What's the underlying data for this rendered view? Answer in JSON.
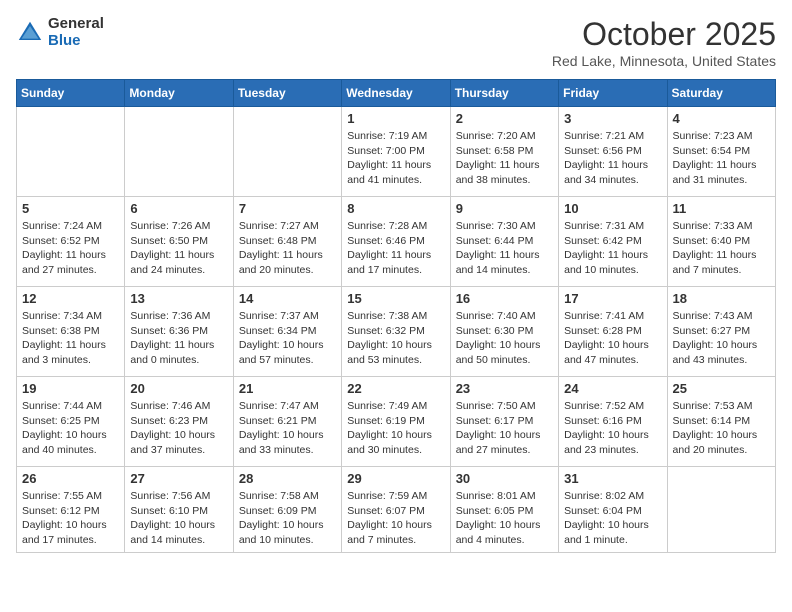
{
  "header": {
    "logo_general": "General",
    "logo_blue": "Blue",
    "month_title": "October 2025",
    "subtitle": "Red Lake, Minnesota, United States"
  },
  "calendar": {
    "days_of_week": [
      "Sunday",
      "Monday",
      "Tuesday",
      "Wednesday",
      "Thursday",
      "Friday",
      "Saturday"
    ],
    "weeks": [
      [
        {
          "day": "",
          "info": ""
        },
        {
          "day": "",
          "info": ""
        },
        {
          "day": "",
          "info": ""
        },
        {
          "day": "1",
          "info": "Sunrise: 7:19 AM\nSunset: 7:00 PM\nDaylight: 11 hours and 41 minutes."
        },
        {
          "day": "2",
          "info": "Sunrise: 7:20 AM\nSunset: 6:58 PM\nDaylight: 11 hours and 38 minutes."
        },
        {
          "day": "3",
          "info": "Sunrise: 7:21 AM\nSunset: 6:56 PM\nDaylight: 11 hours and 34 minutes."
        },
        {
          "day": "4",
          "info": "Sunrise: 7:23 AM\nSunset: 6:54 PM\nDaylight: 11 hours and 31 minutes."
        }
      ],
      [
        {
          "day": "5",
          "info": "Sunrise: 7:24 AM\nSunset: 6:52 PM\nDaylight: 11 hours and 27 minutes."
        },
        {
          "day": "6",
          "info": "Sunrise: 7:26 AM\nSunset: 6:50 PM\nDaylight: 11 hours and 24 minutes."
        },
        {
          "day": "7",
          "info": "Sunrise: 7:27 AM\nSunset: 6:48 PM\nDaylight: 11 hours and 20 minutes."
        },
        {
          "day": "8",
          "info": "Sunrise: 7:28 AM\nSunset: 6:46 PM\nDaylight: 11 hours and 17 minutes."
        },
        {
          "day": "9",
          "info": "Sunrise: 7:30 AM\nSunset: 6:44 PM\nDaylight: 11 hours and 14 minutes."
        },
        {
          "day": "10",
          "info": "Sunrise: 7:31 AM\nSunset: 6:42 PM\nDaylight: 11 hours and 10 minutes."
        },
        {
          "day": "11",
          "info": "Sunrise: 7:33 AM\nSunset: 6:40 PM\nDaylight: 11 hours and 7 minutes."
        }
      ],
      [
        {
          "day": "12",
          "info": "Sunrise: 7:34 AM\nSunset: 6:38 PM\nDaylight: 11 hours and 3 minutes."
        },
        {
          "day": "13",
          "info": "Sunrise: 7:36 AM\nSunset: 6:36 PM\nDaylight: 11 hours and 0 minutes."
        },
        {
          "day": "14",
          "info": "Sunrise: 7:37 AM\nSunset: 6:34 PM\nDaylight: 10 hours and 57 minutes."
        },
        {
          "day": "15",
          "info": "Sunrise: 7:38 AM\nSunset: 6:32 PM\nDaylight: 10 hours and 53 minutes."
        },
        {
          "day": "16",
          "info": "Sunrise: 7:40 AM\nSunset: 6:30 PM\nDaylight: 10 hours and 50 minutes."
        },
        {
          "day": "17",
          "info": "Sunrise: 7:41 AM\nSunset: 6:28 PM\nDaylight: 10 hours and 47 minutes."
        },
        {
          "day": "18",
          "info": "Sunrise: 7:43 AM\nSunset: 6:27 PM\nDaylight: 10 hours and 43 minutes."
        }
      ],
      [
        {
          "day": "19",
          "info": "Sunrise: 7:44 AM\nSunset: 6:25 PM\nDaylight: 10 hours and 40 minutes."
        },
        {
          "day": "20",
          "info": "Sunrise: 7:46 AM\nSunset: 6:23 PM\nDaylight: 10 hours and 37 minutes."
        },
        {
          "day": "21",
          "info": "Sunrise: 7:47 AM\nSunset: 6:21 PM\nDaylight: 10 hours and 33 minutes."
        },
        {
          "day": "22",
          "info": "Sunrise: 7:49 AM\nSunset: 6:19 PM\nDaylight: 10 hours and 30 minutes."
        },
        {
          "day": "23",
          "info": "Sunrise: 7:50 AM\nSunset: 6:17 PM\nDaylight: 10 hours and 27 minutes."
        },
        {
          "day": "24",
          "info": "Sunrise: 7:52 AM\nSunset: 6:16 PM\nDaylight: 10 hours and 23 minutes."
        },
        {
          "day": "25",
          "info": "Sunrise: 7:53 AM\nSunset: 6:14 PM\nDaylight: 10 hours and 20 minutes."
        }
      ],
      [
        {
          "day": "26",
          "info": "Sunrise: 7:55 AM\nSunset: 6:12 PM\nDaylight: 10 hours and 17 minutes."
        },
        {
          "day": "27",
          "info": "Sunrise: 7:56 AM\nSunset: 6:10 PM\nDaylight: 10 hours and 14 minutes."
        },
        {
          "day": "28",
          "info": "Sunrise: 7:58 AM\nSunset: 6:09 PM\nDaylight: 10 hours and 10 minutes."
        },
        {
          "day": "29",
          "info": "Sunrise: 7:59 AM\nSunset: 6:07 PM\nDaylight: 10 hours and 7 minutes."
        },
        {
          "day": "30",
          "info": "Sunrise: 8:01 AM\nSunset: 6:05 PM\nDaylight: 10 hours and 4 minutes."
        },
        {
          "day": "31",
          "info": "Sunrise: 8:02 AM\nSunset: 6:04 PM\nDaylight: 10 hours and 1 minute."
        },
        {
          "day": "",
          "info": ""
        }
      ]
    ]
  }
}
